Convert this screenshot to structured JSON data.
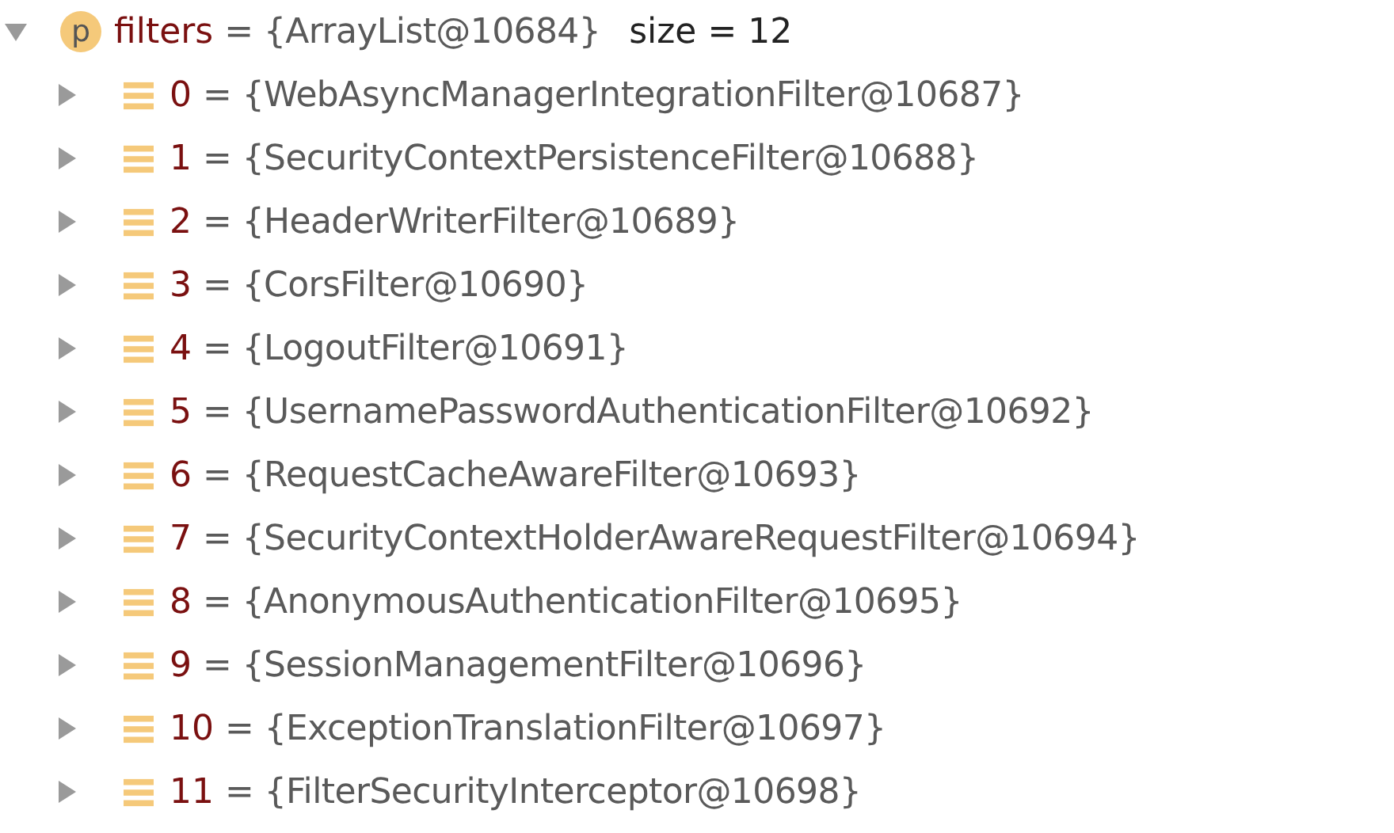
{
  "tree": {
    "badge": "p",
    "name": "filters",
    "value": "= {ArrayList@10684}",
    "info": "size = 12",
    "expanded": true,
    "children": [
      {
        "name": "0",
        "value": "= {WebAsyncManagerIntegrationFilter@10687}",
        "expanded": false
      },
      {
        "name": "1",
        "value": "= {SecurityContextPersistenceFilter@10688}",
        "expanded": false
      },
      {
        "name": "2",
        "value": "= {HeaderWriterFilter@10689}",
        "expanded": false
      },
      {
        "name": "3",
        "value": "= {CorsFilter@10690}",
        "expanded": false
      },
      {
        "name": "4",
        "value": "= {LogoutFilter@10691}",
        "expanded": false
      },
      {
        "name": "5",
        "value": "= {UsernamePasswordAuthenticationFilter@10692}",
        "expanded": false
      },
      {
        "name": "6",
        "value": "= {RequestCacheAwareFilter@10693}",
        "expanded": false
      },
      {
        "name": "7",
        "value": "= {SecurityContextHolderAwareRequestFilter@10694}",
        "expanded": false
      },
      {
        "name": "8",
        "value": "= {AnonymousAuthenticationFilter@10695}",
        "expanded": false
      },
      {
        "name": "9",
        "value": "= {SessionManagementFilter@10696}",
        "expanded": false
      },
      {
        "name": "10",
        "value": "= {ExceptionTranslationFilter@10697}",
        "expanded": false
      },
      {
        "name": "11",
        "value": "= {FilterSecurityInterceptor@10698}",
        "expanded": false
      }
    ]
  }
}
